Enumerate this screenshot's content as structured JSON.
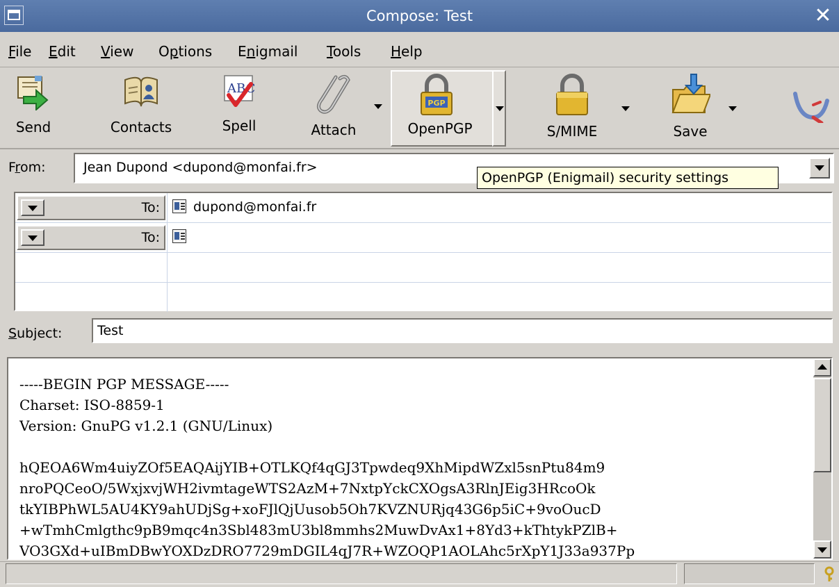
{
  "window": {
    "title": "Compose: Test"
  },
  "menu": [
    {
      "id": "file",
      "pre": "",
      "u": "F",
      "post": "ile"
    },
    {
      "id": "edit",
      "pre": "",
      "u": "E",
      "post": "dit"
    },
    {
      "id": "view",
      "pre": "",
      "u": "V",
      "post": "iew"
    },
    {
      "id": "options",
      "pre": "O",
      "u": "p",
      "post": "tions"
    },
    {
      "id": "enigmail",
      "pre": "E",
      "u": "n",
      "post": "igmail"
    },
    {
      "id": "tools",
      "pre": "",
      "u": "T",
      "post": "ools"
    },
    {
      "id": "help",
      "pre": "",
      "u": "H",
      "post": "elp"
    }
  ],
  "toolbar": {
    "send": "Send",
    "contacts": "Contacts",
    "spell": "Spell",
    "attach": "Attach",
    "openpgp": "OpenPGP",
    "openpgp_badge": "PGP",
    "smime": "S/MIME",
    "save": "Save",
    "spell_badge": "ABC"
  },
  "from": {
    "label_pre": "F",
    "label_u": "r",
    "label_post": "om:",
    "value": "Jean Dupond <dupond@monfai.fr>"
  },
  "tooltip": "OpenPGP (Enigmail) security settings",
  "recipients": [
    {
      "type": "To:",
      "address": "dupond@monfai.fr"
    },
    {
      "type": "To:",
      "address": ""
    }
  ],
  "subject": {
    "label_u": "S",
    "label_post": "ubject:",
    "value": "Test"
  },
  "body": "-----BEGIN PGP MESSAGE-----\nCharset: ISO-8859-1\nVersion: GnuPG v1.2.1 (GNU/Linux)\n\nhQEOA6Wm4uiyZOf5EAQAijYIB+OTLKQf4qGJ3Tpwdeq9XhMipdWZxl5snPtu84m9\nnroPQCeoO/5WxjxvjWH2ivmtageWTS2AzM+7NxtpYckCXOgsA3RlnJEig3HRcoOk\ntkYIBPhWL5AU4KY9ahUDjSg+xoFJlQjUusob5Oh7KVZNURjq43G6p5iC+9voOucD\n+wTmhCmlgthc9pB9mqc4n3Sbl483mU3bl8mmhs2MuwDvAx1+8Yd3+kThtykPZlB+\nVO3GXd+uIBmDBwYOXDzDRO7729mDGIL4qJ7R+WZOQP1AOLAhc5rXpY1J33a937Pp"
}
